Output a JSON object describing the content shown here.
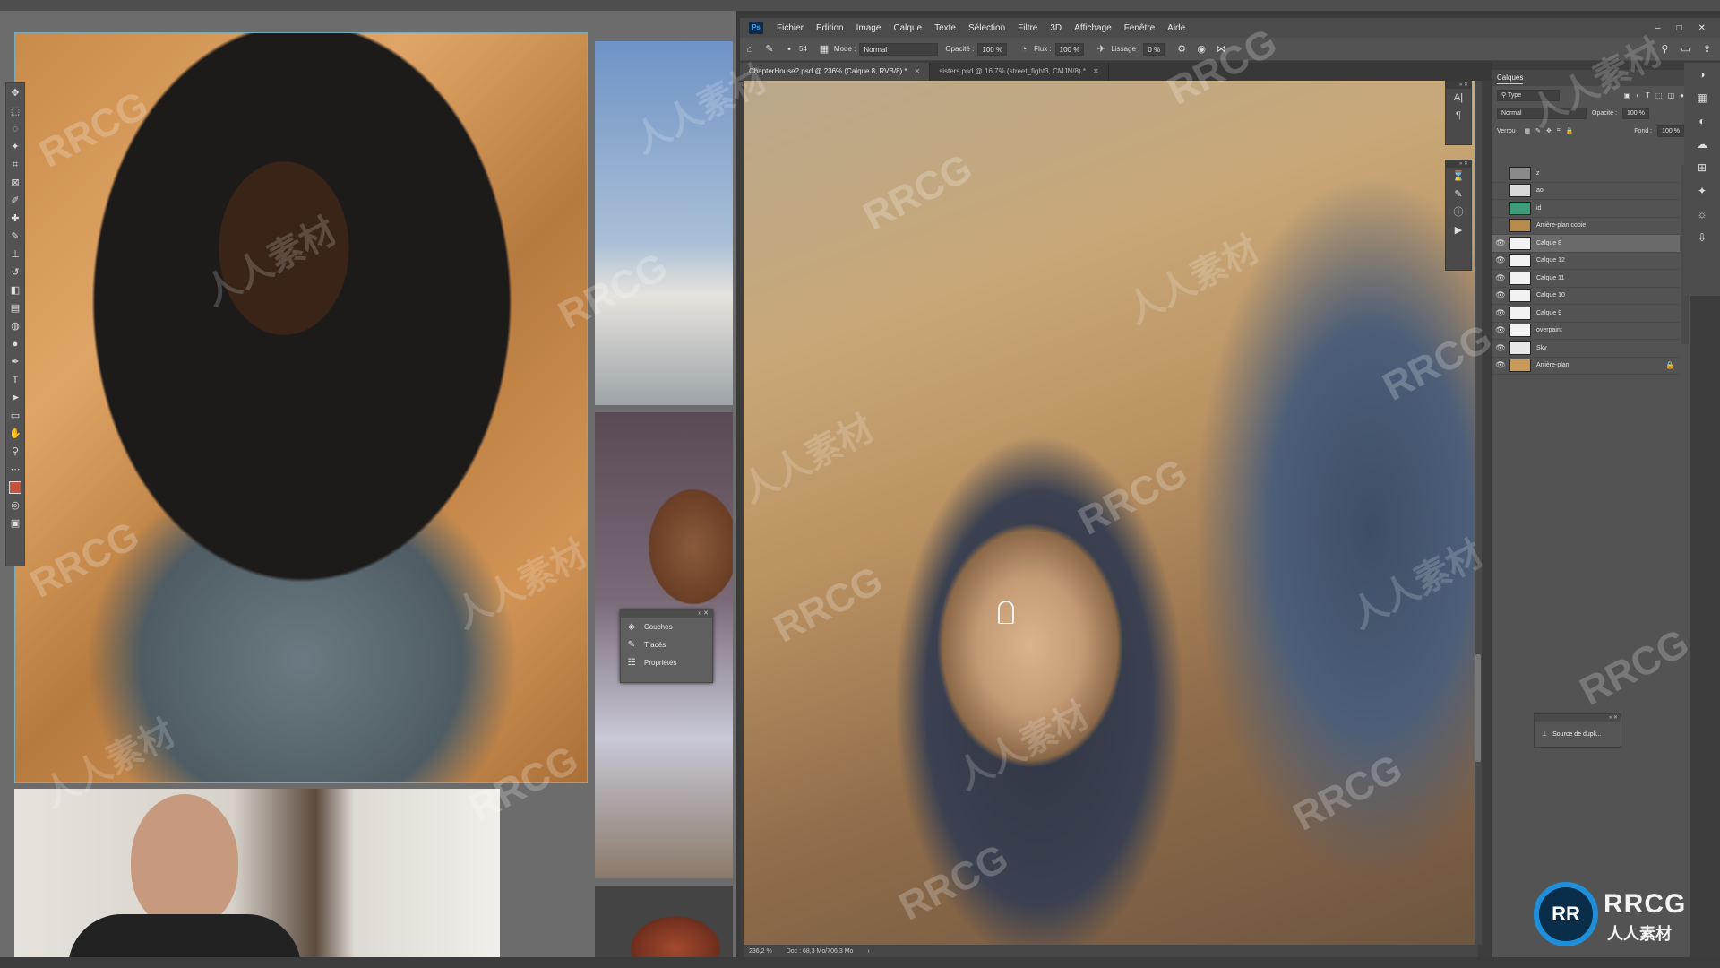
{
  "photoshop": {
    "logo": "Ps",
    "menu": [
      "Fichier",
      "Edition",
      "Image",
      "Calque",
      "Texte",
      "Sélection",
      "Filtre",
      "3D",
      "Affichage",
      "Fenêtre",
      "Aide"
    ],
    "window_controls": {
      "minimize": "–",
      "maximize": "□",
      "close": "✕"
    },
    "options_bar": {
      "brush_size": "54",
      "mode_label": "Mode :",
      "mode_value": "Normal",
      "opacity_label": "Opacité :",
      "opacity_value": "100 %",
      "flow_label": "Flux :",
      "flow_value": "100 %",
      "smoothing_label": "Lissage :",
      "smoothing_value": "0 %"
    },
    "tabs": [
      {
        "label": "ChapterHouse2.psd @ 236% (Calque 8, RVB/8) *",
        "close": "✕"
      },
      {
        "label": "sisters.psd @ 16,7% (street_fight3, CMJN/8) *",
        "close": "✕"
      }
    ],
    "status": {
      "zoom": "236,2 %",
      "doc": "Doc : 68,3 Mo/706,3 Mo"
    },
    "layers_panel": {
      "title": "Calques",
      "filter_kind": "Type",
      "blend_mode": "Normal",
      "opacity_label": "Opacité :",
      "opacity_value": "100 %",
      "lock_label": "Verrou :",
      "fill_label": "Fond :",
      "fill_value": "100 %",
      "layers": [
        {
          "name": "z",
          "visible": false,
          "selected": false,
          "locked": false,
          "thumb": "#8a8a8a"
        },
        {
          "name": "ao",
          "visible": false,
          "selected": false,
          "locked": false,
          "thumb": "#d9d9d9"
        },
        {
          "name": "id",
          "visible": false,
          "selected": false,
          "locked": false,
          "thumb": "#3f9c7a"
        },
        {
          "name": "Arrière-plan copie",
          "visible": false,
          "selected": false,
          "locked": false,
          "thumb": "#b88a4c"
        },
        {
          "name": "Calque 8",
          "visible": true,
          "selected": true,
          "locked": false,
          "thumb": "#f2f2f2"
        },
        {
          "name": "Calque 12",
          "visible": true,
          "selected": false,
          "locked": false,
          "thumb": "#f2f2f2"
        },
        {
          "name": "Calque 11",
          "visible": true,
          "selected": false,
          "locked": false,
          "thumb": "#f2f2f2"
        },
        {
          "name": "Calque 10",
          "visible": true,
          "selected": false,
          "locked": false,
          "thumb": "#f2f2f2"
        },
        {
          "name": "Calque 9",
          "visible": true,
          "selected": false,
          "locked": false,
          "thumb": "#f2f2f2"
        },
        {
          "name": "overpaint",
          "visible": true,
          "selected": false,
          "locked": false,
          "thumb": "#f2f2f2"
        },
        {
          "name": "Sky",
          "visible": true,
          "selected": false,
          "locked": false,
          "thumb": "#e8e8e8"
        },
        {
          "name": "Arrière-plan",
          "visible": true,
          "selected": false,
          "locked": true,
          "thumb": "#c89a5a"
        }
      ]
    },
    "clone_source_panel": {
      "label": "Source de dupli..."
    }
  },
  "floating_panel": {
    "items": [
      {
        "icon": "layers-icon",
        "glyph": "◈",
        "label": "Couches"
      },
      {
        "icon": "paths-icon",
        "glyph": "✎",
        "label": "Tracés"
      },
      {
        "icon": "properties-icon",
        "glyph": "☷",
        "label": "Propriétés"
      }
    ]
  },
  "watermark": {
    "text_latin": "RRCG",
    "text_cn": "人人素材"
  },
  "brand": {
    "circle": "RR",
    "name": "RRCG",
    "sub": "人人素材"
  }
}
